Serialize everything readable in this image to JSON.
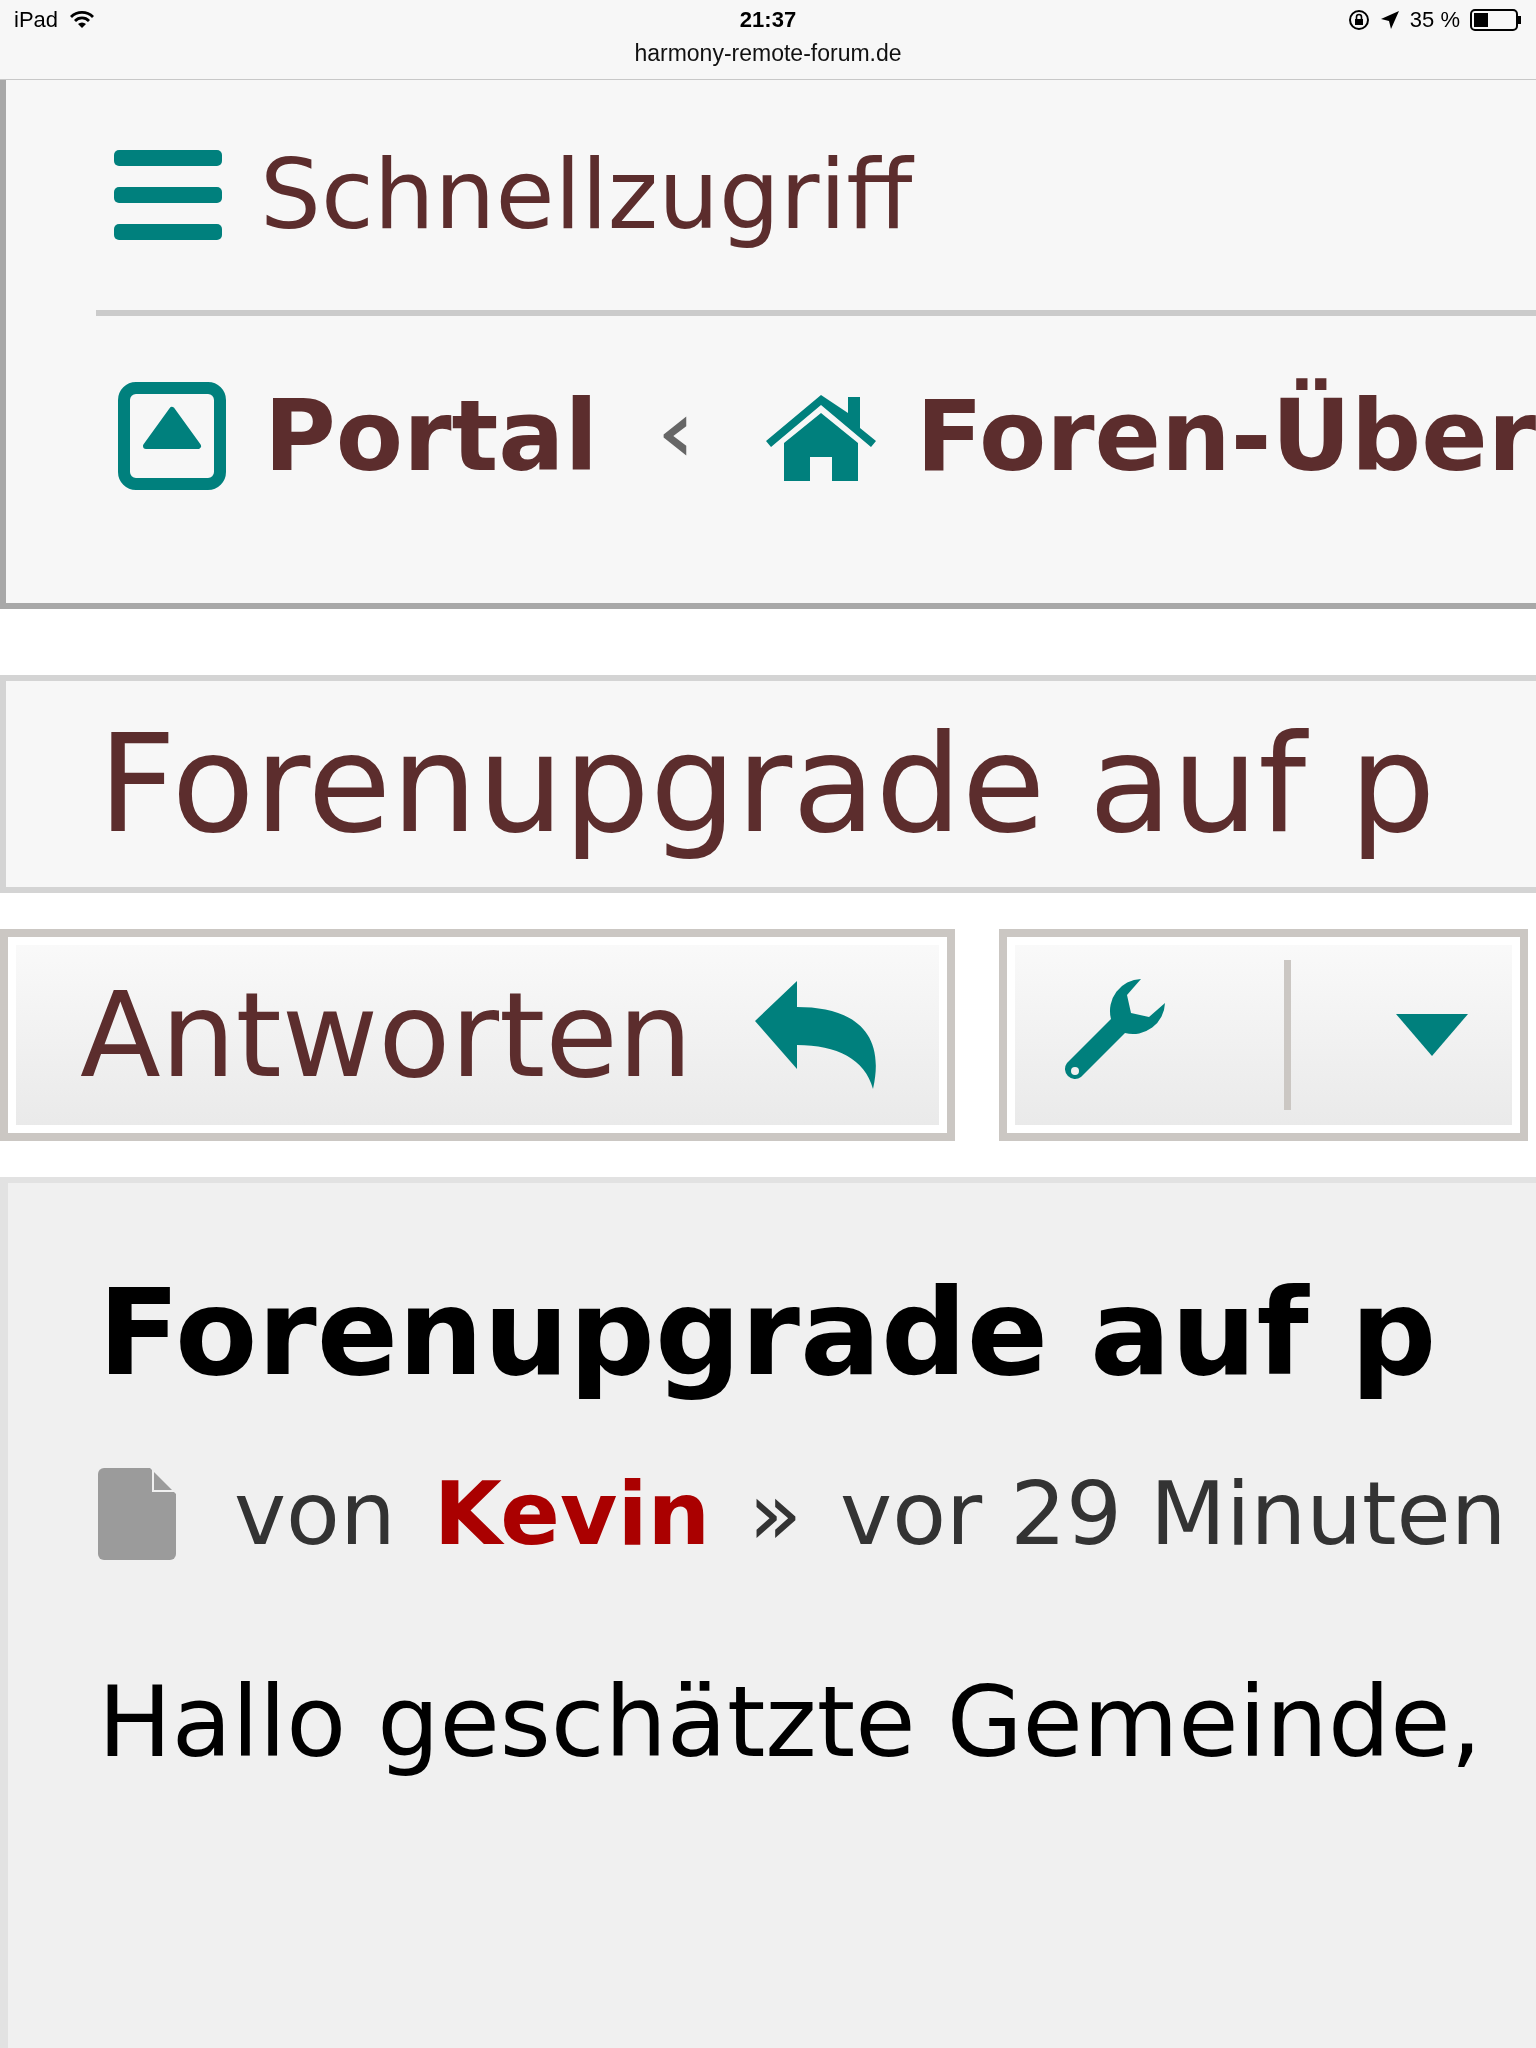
{
  "status_bar": {
    "device": "iPad",
    "time": "21:37",
    "battery": "35 %",
    "url": "harmony-remote-forum.de"
  },
  "quick_access": {
    "label": "Schnellzugriff"
  },
  "breadcrumbs": [
    {
      "label": "Portal",
      "kind": "portal"
    },
    {
      "label": "Foren-Über",
      "kind": "home"
    }
  ],
  "topic_title": "Forenupgrade auf p",
  "actions": {
    "reply": "Antworten"
  },
  "post": {
    "title": "Forenupgrade auf p",
    "by": "von",
    "author": "Kevin",
    "separator": "»",
    "time": "vor 29 Minuten",
    "greeting": "Hallo geschätzte Gemeinde,"
  }
}
